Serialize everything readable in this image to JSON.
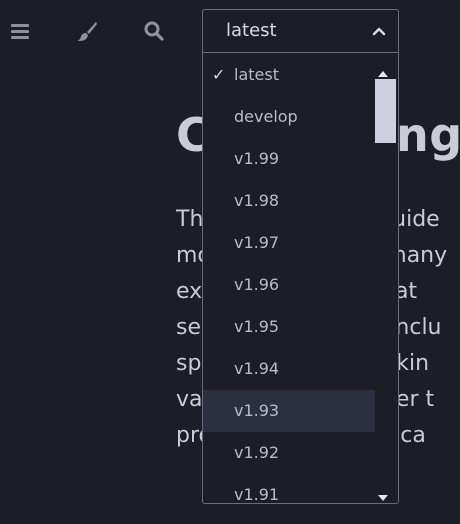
{
  "toolbar": {
    "icons": [
      "menu-icon",
      "brush-icon",
      "search-icon"
    ]
  },
  "version_select": {
    "selected": "latest",
    "options": [
      "latest",
      "develop",
      "v1.99",
      "v1.98",
      "v1.97",
      "v1.96",
      "v1.95",
      "v1.94",
      "v1.93",
      "v1.92",
      "v1.91"
    ],
    "checked_index": 0,
    "hovered_index": 8,
    "check_mark": "✓"
  },
  "content": {
    "heading_start": "C",
    "heading_end": "ng",
    "lines": [
      "Th                      n guide",
      "mo                      e many",
      "ex                       what",
      "se                        o inclu",
      "sp                       hinkin",
      "va                      vever t",
      "pro                      ou ca"
    ]
  },
  "colors": {
    "background": "#1c1d26",
    "text": "#c9cbd6",
    "hover": "#2c2f3f",
    "border": "#6b6e78",
    "scroll_thumb": "#cfd0df"
  }
}
